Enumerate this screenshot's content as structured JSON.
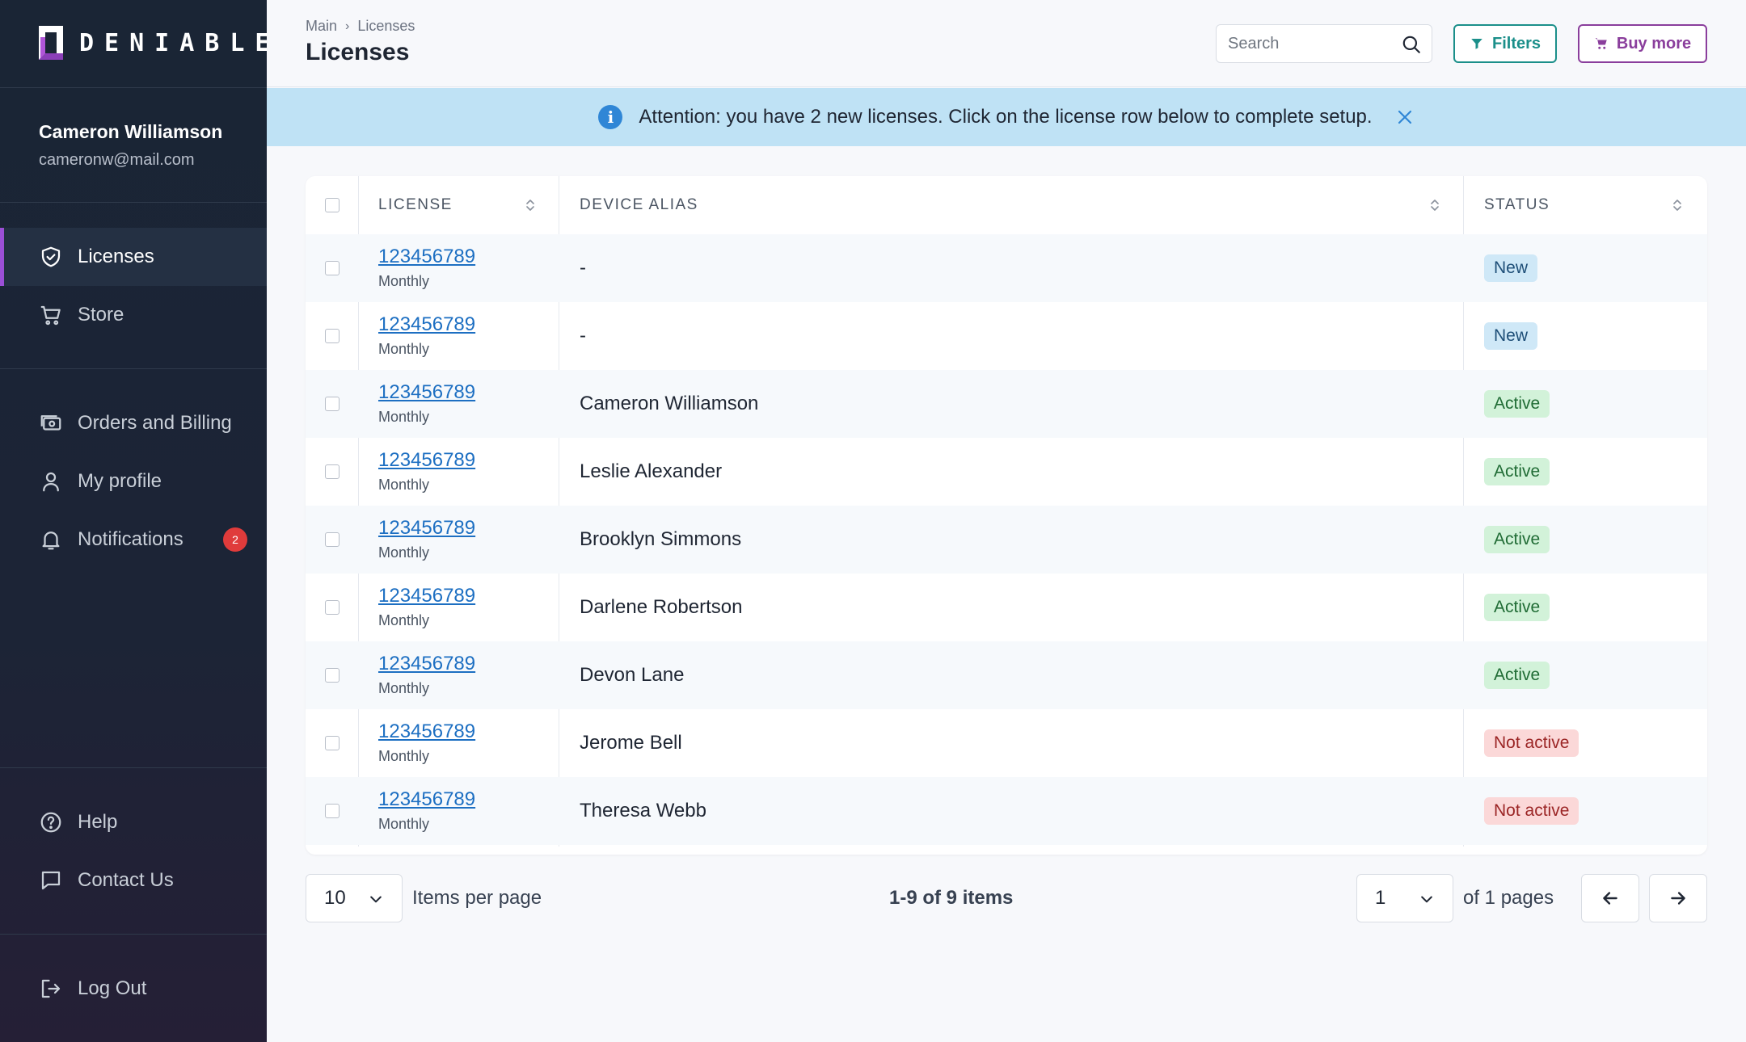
{
  "app": {
    "brand": "DENIABLE"
  },
  "user": {
    "name": "Cameron Williamson",
    "email": "cameronw@mail.com"
  },
  "nav": {
    "licenses": "Licenses",
    "store": "Store",
    "orders": "Orders and Billing",
    "profile": "My profile",
    "notifications": "Notifications",
    "notifications_count": "2",
    "help": "Help",
    "contact": "Contact Us",
    "logout": "Log Out"
  },
  "header": {
    "breadcrumb": [
      "Main",
      "Licenses"
    ],
    "title": "Licenses",
    "search_placeholder": "Search",
    "filters_label": "Filters",
    "buy_label": "Buy more"
  },
  "banner": {
    "text": "Attention: you have 2 new licenses.  Click on the license row below to complete setup."
  },
  "table": {
    "columns": [
      "LICENSE",
      "DEVICE ALIAS",
      "STATUS"
    ],
    "rows": [
      {
        "license": "123456789",
        "plan": "Monthly",
        "alias": "-",
        "status": "New"
      },
      {
        "license": "123456789",
        "plan": "Monthly",
        "alias": "-",
        "status": "New"
      },
      {
        "license": "123456789",
        "plan": "Monthly",
        "alias": "Cameron Williamson",
        "status": "Active"
      },
      {
        "license": "123456789",
        "plan": "Monthly",
        "alias": "Leslie Alexander",
        "status": "Active"
      },
      {
        "license": "123456789",
        "plan": "Monthly",
        "alias": "Brooklyn Simmons",
        "status": "Active"
      },
      {
        "license": "123456789",
        "plan": "Monthly",
        "alias": "Darlene Robertson",
        "status": "Active"
      },
      {
        "license": "123456789",
        "plan": "Monthly",
        "alias": "Devon Lane",
        "status": "Active"
      },
      {
        "license": "123456789",
        "plan": "Monthly",
        "alias": "Jerome Bell",
        "status": "Not active"
      },
      {
        "license": "123456789",
        "plan": "Monthly",
        "alias": "Theresa Webb",
        "status": "Not active"
      }
    ]
  },
  "status_colors": {
    "New": {
      "bg": "#cfe8f7",
      "fg": "#1f4f78"
    },
    "Active": {
      "bg": "#d2f2d9",
      "fg": "#1f6b34"
    },
    "Not active": {
      "bg": "#fbd8d8",
      "fg": "#9b2525"
    }
  },
  "pagination": {
    "per_page": "10",
    "per_page_label": "Items per page",
    "summary": "1-9 of 9 items",
    "page": "1",
    "pages_label": "of 1 pages"
  },
  "colors": {
    "accent": "#9b4fd6",
    "teal": "#1b8f8a",
    "purple": "#8a3e9c",
    "link": "#1d6fc2"
  }
}
